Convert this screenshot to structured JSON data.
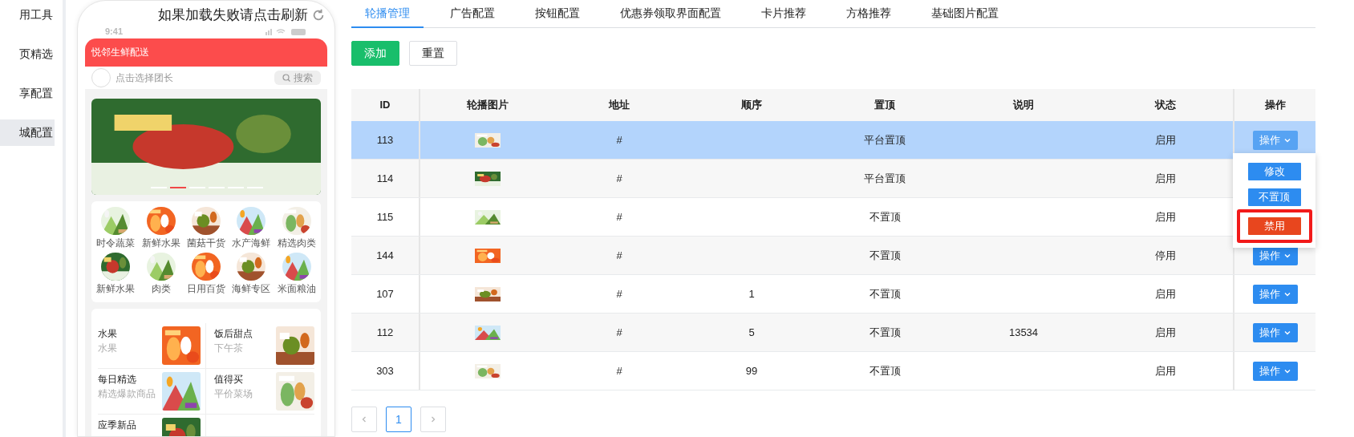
{
  "sidebar": {
    "items": [
      {
        "label": "用工具",
        "selected": false
      },
      {
        "label": "页精选",
        "selected": false
      },
      {
        "label": "享配置",
        "selected": false
      },
      {
        "label": "城配置",
        "selected": true
      }
    ]
  },
  "preview": {
    "notice": "如果加载失败请点击刷新",
    "status_time": "9:41",
    "header_title": "悦邻生鲜配送",
    "leader_placeholder": "点击选择团长",
    "search_label": "搜索",
    "banner_dots": [
      {
        "selected": false
      },
      {
        "selected": true
      },
      {
        "selected": false
      },
      {
        "selected": false
      },
      {
        "selected": false
      },
      {
        "selected": false
      }
    ],
    "categories": [
      {
        "label": "时令蔬菜"
      },
      {
        "label": "新鲜水果"
      },
      {
        "label": "菌菇干货"
      },
      {
        "label": "水产海鲜"
      },
      {
        "label": "精选肉类"
      },
      {
        "label": "新鲜水果"
      },
      {
        "label": "肉类"
      },
      {
        "label": "日用百货"
      },
      {
        "label": "海鲜专区"
      },
      {
        "label": "米面粮油"
      }
    ],
    "cards": [
      {
        "title": "水果",
        "subtitle": "水果"
      },
      {
        "title": "饭后甜点",
        "subtitle": "下午茶"
      },
      {
        "title": "每日精选",
        "subtitle": "精选爆款商品"
      },
      {
        "title": "值得买",
        "subtitle": "平价菜场"
      },
      {
        "title": "应季新品"
      }
    ]
  },
  "tabs": [
    {
      "label": "轮播管理",
      "selected": true
    },
    {
      "label": "广告配置",
      "selected": false
    },
    {
      "label": "按钮配置",
      "selected": false
    },
    {
      "label": "优惠券领取界面配置",
      "selected": false
    },
    {
      "label": "卡片推荐",
      "selected": false
    },
    {
      "label": "方格推荐",
      "selected": false
    },
    {
      "label": "基础图片配置",
      "selected": false
    }
  ],
  "toolbar": {
    "buttons": [
      {
        "label": "添加",
        "kind": "primary"
      },
      {
        "label": "重置",
        "kind": "default"
      }
    ]
  },
  "table": {
    "columns": [
      "ID",
      "轮播图片",
      "地址",
      "顺序",
      "置顶",
      "说明",
      "状态",
      "操作"
    ],
    "rows": [
      {
        "id": "113",
        "address": "#",
        "pin": "平台置顶",
        "status": "启用",
        "action": "操作",
        "selected": true
      },
      {
        "id": "114",
        "address": "#",
        "pin": "平台置顶",
        "status": "启用",
        "selected": false
      },
      {
        "id": "115",
        "address": "#",
        "pin": "不置顶",
        "status": "启用",
        "selected": false
      },
      {
        "id": "144",
        "address": "#",
        "pin": "不置顶",
        "status": "停用",
        "action": "操作",
        "selected": false
      },
      {
        "id": "107",
        "address": "#",
        "order": "1",
        "pin": "不置顶",
        "status": "启用",
        "action": "操作",
        "selected": false
      },
      {
        "id": "112",
        "address": "#",
        "order": "5",
        "pin": "不置顶",
        "note": "13534",
        "status": "启用",
        "action": "操作",
        "selected": false
      },
      {
        "id": "303",
        "address": "#",
        "order": "99",
        "pin": "不置顶",
        "status": "启用",
        "action": "操作",
        "selected": false
      }
    ]
  },
  "action_menu": {
    "items": [
      {
        "label": "修改",
        "kind": "normal",
        "highlighted": false
      },
      {
        "label": "不置顶",
        "kind": "normal",
        "highlighted": false
      },
      {
        "label": "禁用",
        "kind": "danger",
        "highlighted": true
      }
    ]
  },
  "pagination": {
    "pages": [
      {
        "label": "1",
        "selected": true
      }
    ]
  }
}
